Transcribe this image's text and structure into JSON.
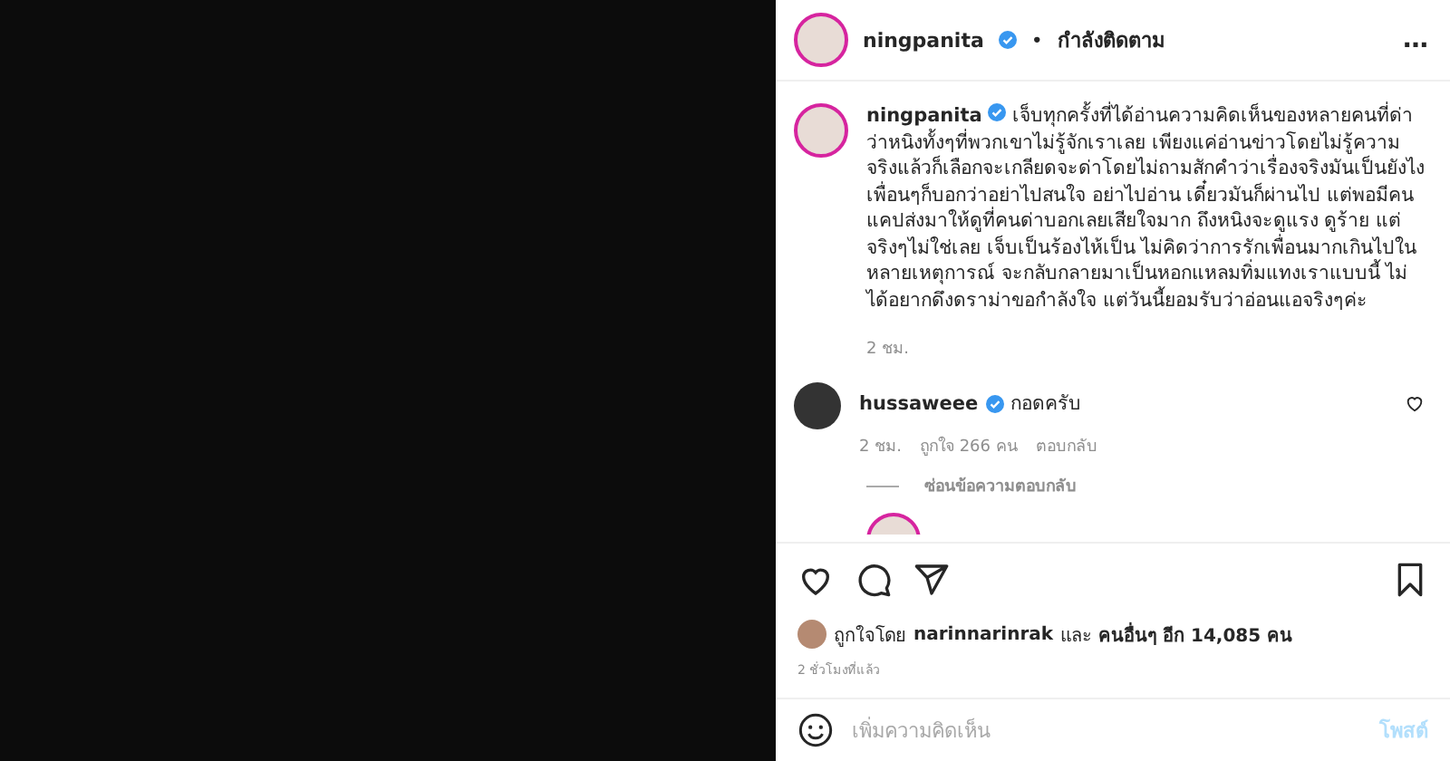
{
  "header": {
    "username": "ningpanita",
    "verified": true,
    "separator": "•",
    "follow_status": "กำลังติดตาม",
    "more": "…"
  },
  "caption": {
    "username": "ningpanita",
    "verified": true,
    "text": "เจ็บทุกครั้งที่ได้อ่านความคิดเห็นของหลายคนที่ด่าว่าหนิงทั้งๆที่พวกเขาไม่รู้จักเราเลย เพียงแค่อ่านข่าวโดยไม่รู้ความจริงแล้วก็เลือกจะเกลียดจะด่าโดยไม่ถามสักคำว่าเรื่องจริงมันเป็นยังไง เพื่อนๆก็บอกว่าอย่าไปสนใจ อย่าไปอ่าน เดี๋ยวมันก็ผ่านไป แต่พอมีคนแคปส่งมาให้ดูที่คนด่าบอกเลยเสียใจมาก ถึงหนิงจะดูแรง ดูร้าย แต่จริงๆไม่ใช่เลย เจ็บเป็นร้องไห้เป็น ไม่คิดว่าการรักเพื่อนมากเกินไปในหลายเหตุการณ์ จะกลับกลายมาเป็นหอกแหลมทิ่มแทงเราแบบนี้ ไม่ได้อยากดึงดราม่าขอกำลังใจ แต่วันนี้ยอมรับว่าอ่อนแอจริงๆค่ะ",
    "time": "2 ชม."
  },
  "comments": [
    {
      "username": "hussaweee",
      "verified": true,
      "text": "กอดครับ",
      "time": "2 ชม.",
      "likes": "ถูกใจ 266 คน",
      "reply": "ตอบกลับ",
      "liked": false,
      "hide_replies": "ซ่อนข้อความตอบกลับ"
    }
  ],
  "likes": {
    "prefix": "ถูกใจโดย",
    "user": "narinnarinrak",
    "and": "และ",
    "others": "คนอื่นๆ อีก 14,085 คน"
  },
  "post_time": "2 ชั่วโมงที่แล้ว",
  "comment_box": {
    "placeholder": "เพิ่มความคิดเห็น",
    "post_button": "โพสต์"
  }
}
